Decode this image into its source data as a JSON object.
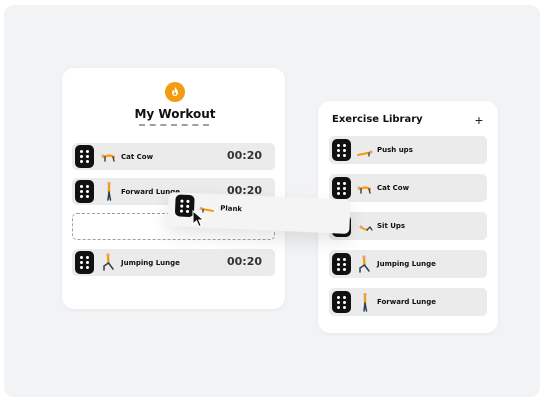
{
  "workout": {
    "title": "My Workout",
    "icon": "flame-icon",
    "accent": "#f39c12",
    "items": [
      {
        "name": "Cat Cow",
        "time": "00:20",
        "icon": "cat-cow-figure-icon"
      },
      {
        "name": "Forward Lunge",
        "time": "00:20",
        "icon": "forward-lunge-figure-icon"
      },
      {
        "name": "Jumping Lunge",
        "time": "00:20",
        "icon": "jumping-lunge-figure-icon"
      }
    ]
  },
  "drag": {
    "name": "Plank",
    "icon": "plank-figure-icon"
  },
  "library": {
    "title": "Exercise Library",
    "add_label": "+",
    "items": [
      {
        "name": "Push ups",
        "icon": "push-up-figure-icon"
      },
      {
        "name": "Cat Cow",
        "icon": "cat-cow-figure-icon"
      },
      {
        "name": "Sit Ups",
        "icon": "sit-up-figure-icon"
      },
      {
        "name": "Jumping Lunge",
        "icon": "jumping-lunge-figure-icon"
      },
      {
        "name": "Forward Lunge",
        "icon": "forward-lunge-figure-icon"
      }
    ]
  }
}
